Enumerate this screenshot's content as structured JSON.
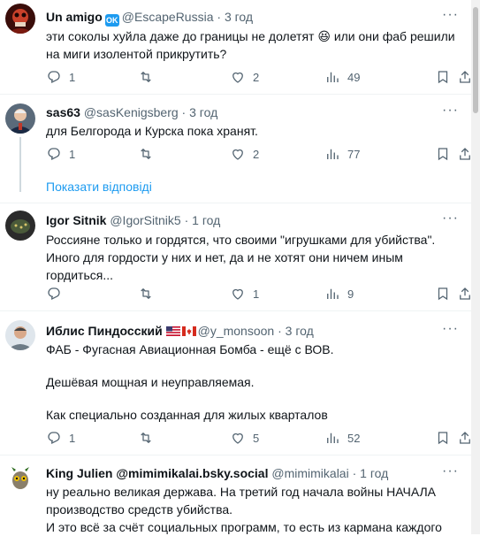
{
  "tweets": [
    {
      "name": "Un amigo",
      "handle": "@EscapeRussia",
      "time": "3 год",
      "verified_badge": "OK",
      "lines": [
        "эти соколы хуйла даже до границы не долетят 😆 или они фаб решили",
        "на миги изолентой прикрутить?"
      ],
      "replies": "1",
      "retweets": "",
      "likes": "2",
      "views": "49"
    },
    {
      "name": "sas63",
      "handle": "@sasKenigsberg",
      "time": "3 год",
      "lines": [
        "для Белгорода и Курска пока хранят."
      ],
      "replies": "1",
      "retweets": "",
      "likes": "2",
      "views": "77"
    },
    {
      "name": "Igor Sitnik",
      "handle": "@IgorSitnik5",
      "time": "1 год",
      "lines": [
        "Россияне только и гордятся, что своими \"игрушками для убийства\".",
        "Иного для гордости у них и нет, да и не хотят они ничем иным",
        "гордиться..."
      ],
      "replies": "",
      "retweets": "",
      "likes": "1",
      "views": "9"
    },
    {
      "name": "Иблис Пиндосский",
      "handle": "@y_monsoon",
      "time": "3 год",
      "lines": [
        "ФАБ - Фугасная Авиационная Бомба - ещё с ВОВ.",
        "",
        "Дешёвая мощная и неуправляемая.",
        "",
        "Как специально созданная для жилых кварталов"
      ],
      "replies": "1",
      "retweets": "",
      "likes": "5",
      "views": "52"
    },
    {
      "name": "King Julien @mimimikalai.bsky.social",
      "handle": "@mimimikalai",
      "time": "1 год",
      "lines": [
        "ну реально великая держава. На третий год начала войны НАЧАЛА",
        "производство средств убийства.",
        "И это всё за счёт социальных программ, то есть из кармана каждого"
      ]
    }
  ],
  "show_replies": "Показати відповіді",
  "dot": "·",
  "more": "···",
  "icons": {
    "reply": "reply-icon",
    "retweet": "retweet-icon",
    "like": "heart-icon",
    "views": "views-icon",
    "bookmark": "bookmark-icon",
    "share": "share-icon"
  },
  "colors": {
    "accent": "#1d9bf0",
    "muted": "#536471",
    "separator": "#eff3f4"
  }
}
